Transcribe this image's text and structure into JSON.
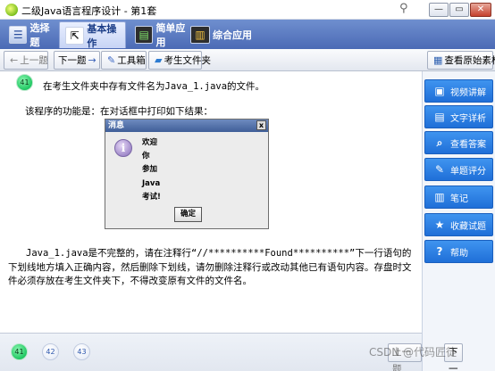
{
  "window": {
    "title": "二级Java语言程序设计 - 第1套",
    "controls": {
      "minimize": "—",
      "maximize": "▭",
      "close": "✕"
    }
  },
  "tabs": [
    {
      "label": "选择题",
      "icon": "select-icon",
      "active": false
    },
    {
      "label": "基本操作",
      "icon": "basic-op-icon",
      "active": true
    },
    {
      "label": "简单应用",
      "icon": "simple-app-icon",
      "active": false
    },
    {
      "label": "综合应用",
      "icon": "combo-app-icon",
      "active": false
    }
  ],
  "toolbar": {
    "prev": "上一题",
    "next": "下一题",
    "tools": "工具箱",
    "student_folder": "考生文件夹",
    "view_source": "查看原始素材"
  },
  "question": {
    "number": "41",
    "intro": "在考生文件夹中存有文件名为Java_1.java的文件。",
    "function_line": "该程序的功能是：在对话框中打印如下结果：",
    "instructions": "Java_1.java是不完整的，请在注释行“//**********Found**********”下一行语句的下划线地方填入正确内容，然后删除下划线，请勿删除注释行或改动其他已有语句内容。存盘时文件必须存放在考生文件夹下，不得改变原有文件的文件名。"
  },
  "dialog": {
    "title": "消息",
    "close": "x",
    "lines": [
      "欢迎",
      "你",
      "参加",
      "Java",
      "考试!"
    ],
    "ok": "确定"
  },
  "sidebar": {
    "items": [
      {
        "label": "视频讲解",
        "icon": "video-icon"
      },
      {
        "label": "文字详析",
        "icon": "text-analysis-icon"
      },
      {
        "label": "查看答案",
        "icon": "search-icon"
      },
      {
        "label": "单题评分",
        "icon": "score-icon"
      },
      {
        "label": "笔记",
        "icon": "note-icon"
      },
      {
        "label": "收藏试题",
        "icon": "star-icon"
      },
      {
        "label": "帮助",
        "icon": "help-icon"
      }
    ]
  },
  "bottom": {
    "question_numbers": [
      "41",
      "42",
      "43"
    ],
    "current": "41",
    "prev": "上一题",
    "next": "下一题"
  },
  "watermark": "CSDN @代码匠徒"
}
